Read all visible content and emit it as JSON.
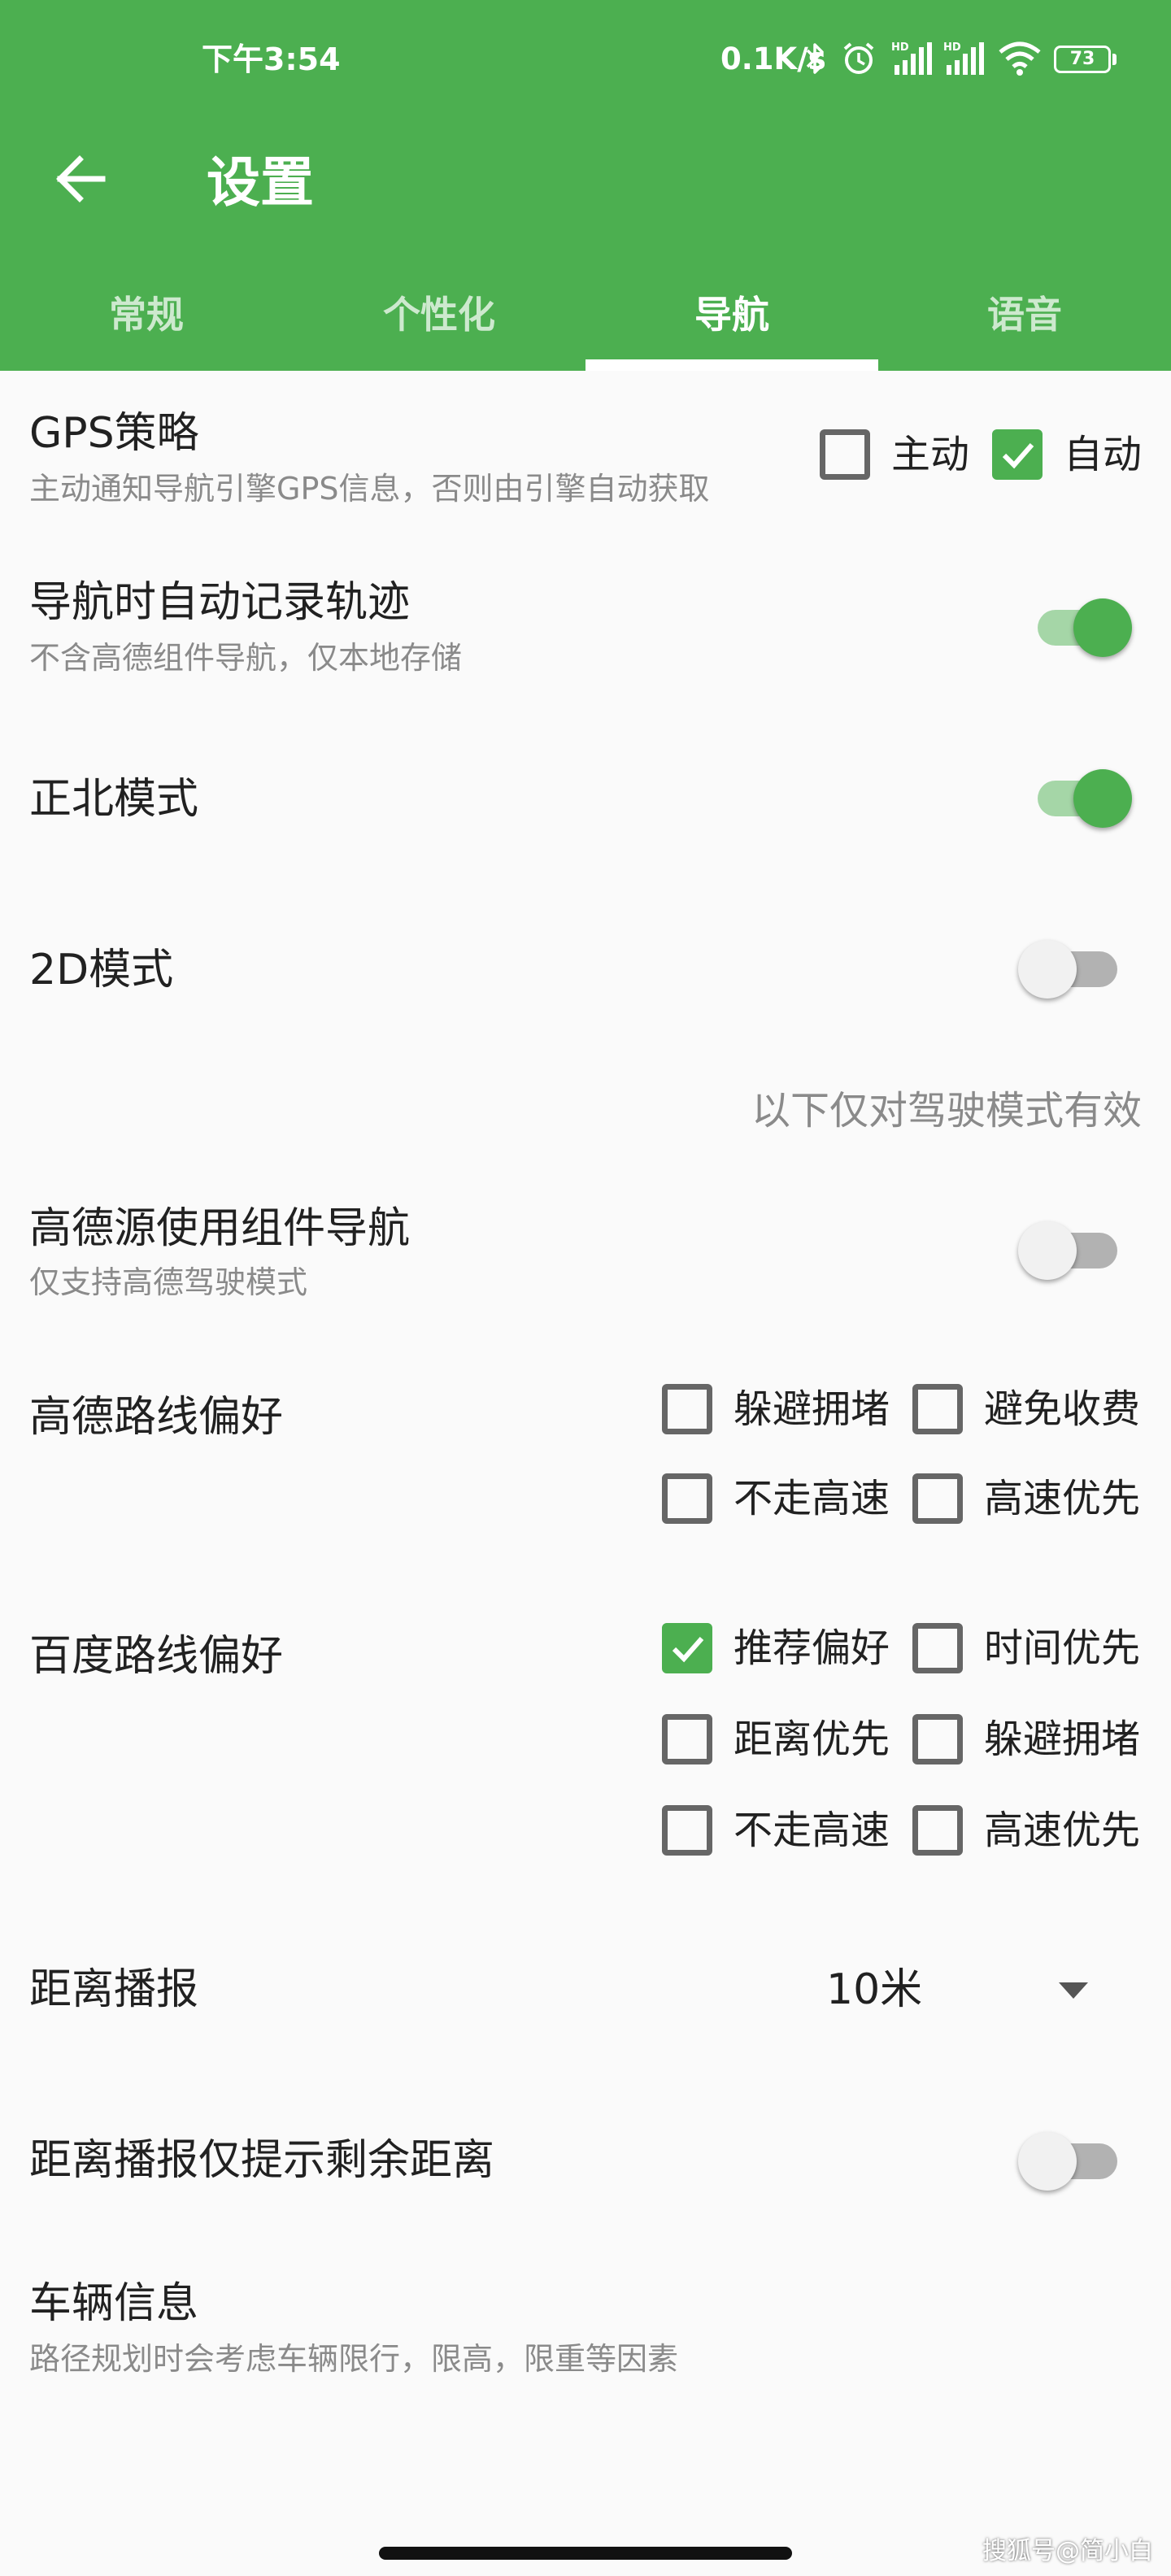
{
  "status_bar": {
    "time": "下午3:54",
    "net_speed": "0.1K/s",
    "battery": "73",
    "icons": [
      "bluetooth-icon",
      "alarm-icon",
      "hd-signal-icon",
      "hd-signal-icon",
      "wifi-icon",
      "battery-icon"
    ]
  },
  "toolbar": {
    "back_icon": "arrow-left-icon",
    "title": "设置"
  },
  "tabs": [
    {
      "label": "常规",
      "active": false
    },
    {
      "label": "个性化",
      "active": false
    },
    {
      "label": "导航",
      "active": true
    },
    {
      "label": "语音",
      "active": false
    }
  ],
  "colors": {
    "primary": "#4caf50",
    "switch_track_on": "#a5d6a7"
  },
  "gps": {
    "title": "GPS策略",
    "subtitle": "主动通知导航引擎GPS信息，否则由引擎自动获取",
    "options": [
      {
        "label": "主动",
        "checked": false
      },
      {
        "label": "自动",
        "checked": true
      }
    ]
  },
  "auto_track": {
    "title": "导航时自动记录轨迹",
    "subtitle": "不含高德组件导航，仅本地存储",
    "on": true
  },
  "north_mode": {
    "title": "正北模式",
    "on": true
  },
  "mode_2d": {
    "title": "2D模式",
    "on": false
  },
  "drive_note": "以下仅对驾驶模式有效",
  "amap_component": {
    "title": "高德源使用组件导航",
    "subtitle": "仅支持高德驾驶模式",
    "on": false
  },
  "amap_route": {
    "title": "高德路线偏好",
    "options": [
      {
        "label": "躲避拥堵",
        "checked": false
      },
      {
        "label": "避免收费",
        "checked": false
      },
      {
        "label": "不走高速",
        "checked": false
      },
      {
        "label": "高速优先",
        "checked": false
      }
    ]
  },
  "baidu_route": {
    "title": "百度路线偏好",
    "options": [
      {
        "label": "推荐偏好",
        "checked": true
      },
      {
        "label": "时间优先",
        "checked": false
      },
      {
        "label": "距离优先",
        "checked": false
      },
      {
        "label": "躲避拥堵",
        "checked": false
      },
      {
        "label": "不走高速",
        "checked": false
      },
      {
        "label": "高速优先",
        "checked": false
      }
    ]
  },
  "distance_broadcast": {
    "title": "距离播报",
    "value": "10米"
  },
  "remaining_only": {
    "title": "距离播报仅提示剩余距离",
    "on": false
  },
  "vehicle": {
    "title": "车辆信息",
    "subtitle": "路径规划时会考虑车辆限行，限高，限重等因素"
  },
  "watermark": "搜狐号@简小白"
}
